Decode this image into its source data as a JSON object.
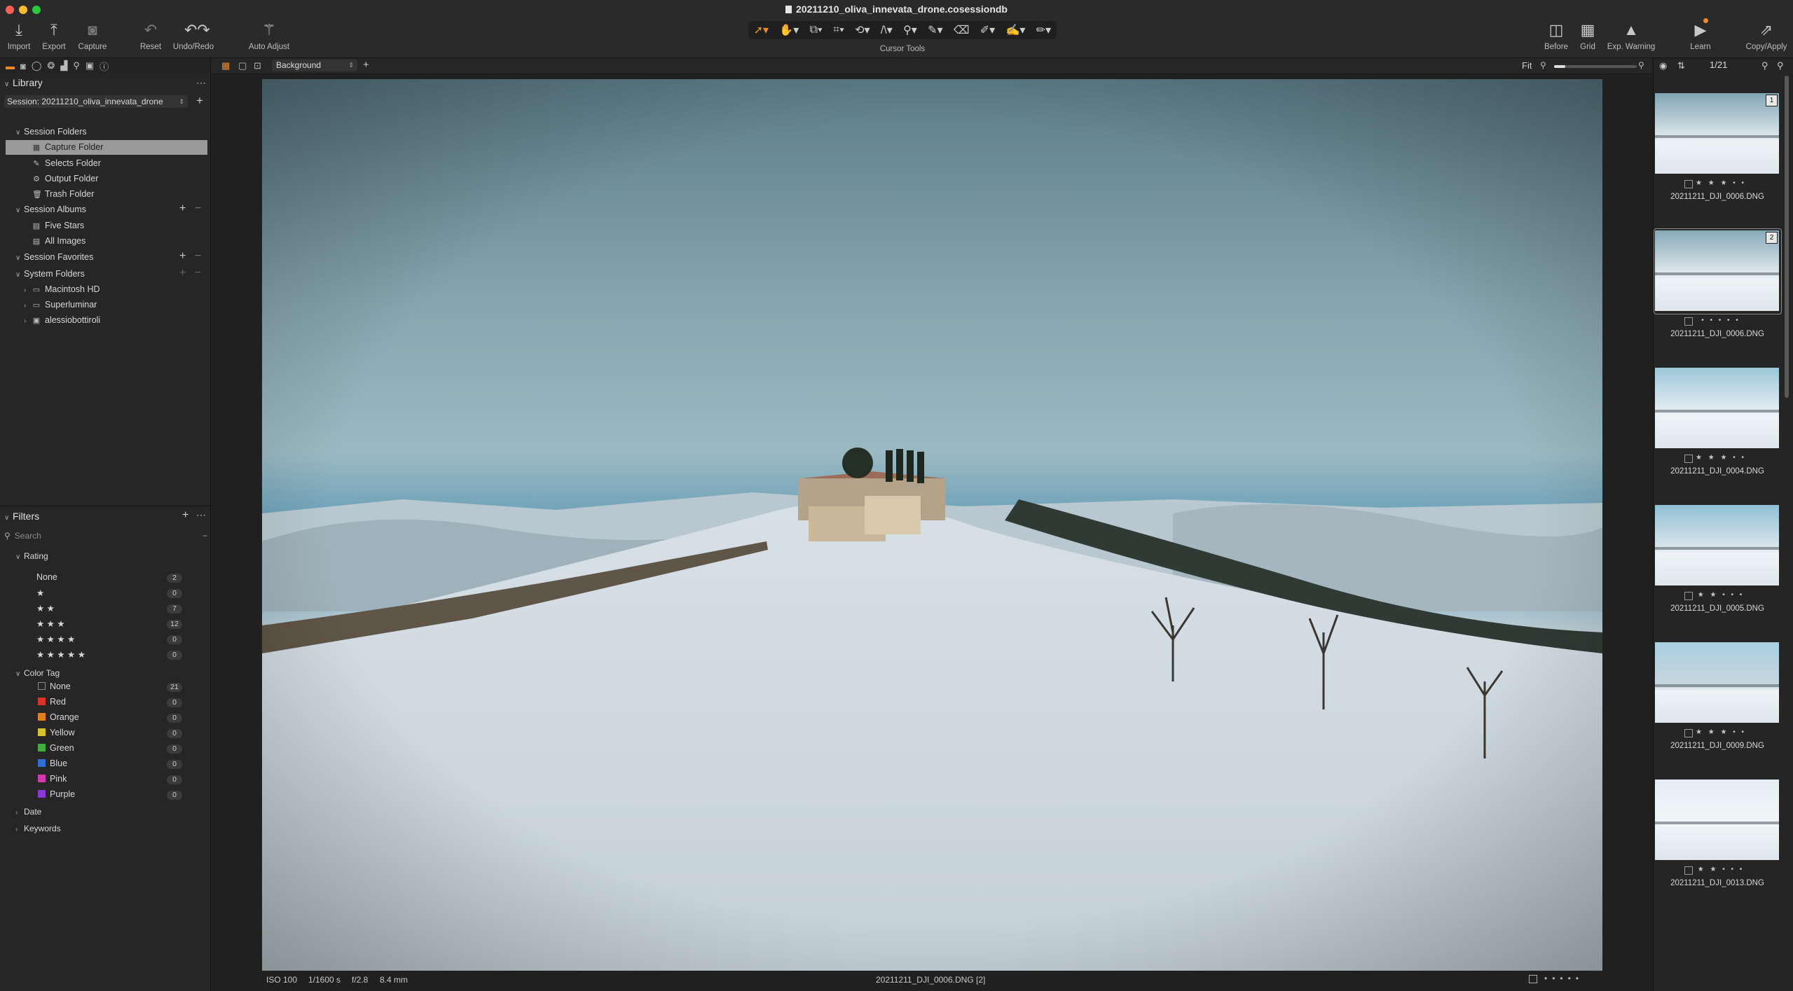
{
  "window": {
    "title": "20211210_oliva_innevata_drone.cosessiondb"
  },
  "toolbar": {
    "left": [
      {
        "label": "Import",
        "icon": "import-icon"
      },
      {
        "label": "Export",
        "icon": "export-icon"
      },
      {
        "label": "Capture",
        "icon": "camera-icon"
      },
      {
        "label": "Reset",
        "icon": "reset-icon"
      },
      {
        "label": "Undo/Redo",
        "icon": "undo-redo-icon"
      },
      {
        "label": "Auto Adjust",
        "icon": "magic-wand-icon"
      }
    ],
    "cursor_tools_label": "Cursor Tools",
    "right": [
      {
        "label": "Before",
        "icon": "before-icon"
      },
      {
        "label": "Grid",
        "icon": "grid-icon"
      },
      {
        "label": "Exp. Warning",
        "icon": "warning-icon"
      },
      {
        "label": "Learn",
        "icon": "learn-icon"
      },
      {
        "label": "Copy/Apply",
        "icon": "copy-apply-icon"
      }
    ]
  },
  "library": {
    "title": "Library",
    "session_label": "Session: 20211210_oliva_innevata_drone",
    "session_folders": {
      "title": "Session Folders",
      "items": [
        "Capture Folder",
        "Selects Folder",
        "Output Folder",
        "Trash Folder"
      ]
    },
    "session_albums": {
      "title": "Session Albums",
      "items": [
        "Five Stars",
        "All Images"
      ]
    },
    "session_favorites": {
      "title": "Session Favorites"
    },
    "system_folders": {
      "title": "System Folders",
      "items": [
        "Macintosh HD",
        "Superluminar",
        "alessiobottiroli"
      ]
    }
  },
  "filters": {
    "title": "Filters",
    "search_placeholder": "Search",
    "rating": {
      "title": "Rating",
      "rows": [
        {
          "label": "None",
          "count": "2"
        },
        {
          "label": "★",
          "count": "0"
        },
        {
          "label": "★ ★",
          "count": "7"
        },
        {
          "label": "★ ★ ★",
          "count": "12"
        },
        {
          "label": "★ ★ ★ ★",
          "count": "0"
        },
        {
          "label": "★ ★ ★ ★ ★",
          "count": "0"
        }
      ]
    },
    "color_tag": {
      "title": "Color Tag",
      "rows": [
        {
          "label": "None",
          "count": "21",
          "color": "none"
        },
        {
          "label": "Red",
          "count": "0",
          "color": "#d9342b"
        },
        {
          "label": "Orange",
          "count": "0",
          "color": "#e0801f"
        },
        {
          "label": "Yellow",
          "count": "0",
          "color": "#d6c22a"
        },
        {
          "label": "Green",
          "count": "0",
          "color": "#3fae3a"
        },
        {
          "label": "Blue",
          "count": "0",
          "color": "#2f6fd6"
        },
        {
          "label": "Pink",
          "count": "0",
          "color": "#d43ab0"
        },
        {
          "label": "Purple",
          "count": "0",
          "color": "#8a3ad4"
        }
      ]
    },
    "date": "Date",
    "keywords": "Keywords"
  },
  "viewer": {
    "background_select": "Background",
    "fit_label": "Fit",
    "status": {
      "iso": "ISO 100",
      "shutter": "1/1600 s",
      "aperture": "f/2.8",
      "focal": "8.4 mm",
      "filename": "20211211_DJI_0006.DNG [2]"
    }
  },
  "filmstrip": {
    "counter": "1/21",
    "items": [
      {
        "name": "20211211_DJI_0006.DNG",
        "stars": "★ ★ ★ • •",
        "badge": "1",
        "selected": false
      },
      {
        "name": "20211211_DJI_0006.DNG",
        "stars": "• • • • •",
        "badge": "2",
        "selected": true
      },
      {
        "name": "20211211_DJI_0004.DNG",
        "stars": "★ ★ ★ • •",
        "badge": "",
        "selected": false
      },
      {
        "name": "20211211_DJI_0005.DNG",
        "stars": "★ ★ • • •",
        "badge": "",
        "selected": false
      },
      {
        "name": "20211211_DJI_0009.DNG",
        "stars": "★ ★ ★ • •",
        "badge": "",
        "selected": false
      },
      {
        "name": "20211211_DJI_0013.DNG",
        "stars": "★ ★ • • •",
        "badge": "",
        "selected": false
      }
    ]
  },
  "colors": {
    "accent": "#f08a24",
    "panel": "#262626",
    "viewer_bg": "#202020"
  }
}
